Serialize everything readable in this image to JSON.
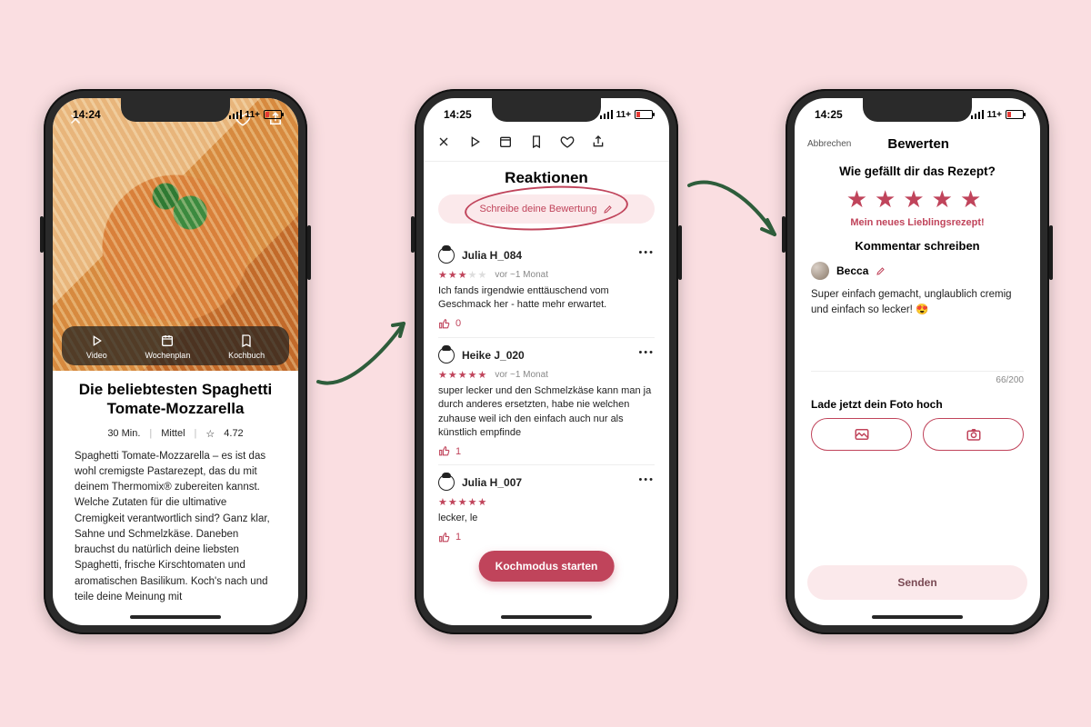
{
  "status": {
    "time1": "14:24",
    "time2": "14:25",
    "time3": "14:25",
    "batt": "11+"
  },
  "phone1": {
    "quick": {
      "video": "Video",
      "plan": "Wochenplan",
      "book": "Kochbuch"
    },
    "title": "Die beliebtesten Spaghetti Tomate-Mozzarella",
    "duration": "30 Min.",
    "difficulty": "Mittel",
    "rating": "4.72",
    "description": "Spaghetti Tomate-Mozzarella – es ist das wohl cremigste Pastarezept, das du mit deinem Thermomix® zubereiten kannst. Welche Zutaten für die ultimative Cremigkeit verantwortlich sind? Ganz klar, Sahne und Schmelzkäse. Daneben brauchst du natürlich deine liebsten Spaghetti, frische Kirschtomaten und aromatischen Basilikum. Koch's nach und teile deine Meinung mit"
  },
  "phone2": {
    "heading": "Reaktionen",
    "write": "Schreibe deine Bewertung",
    "cta": "Kochmodus starten",
    "reviews": [
      {
        "user": "Julia H_084",
        "stars": 3,
        "ago": "vor ~1 Monat",
        "text": "Ich fands irgendwie enttäuschend vom Geschmack her - hatte mehr erwartet.",
        "likes": "0"
      },
      {
        "user": "Heike J_020",
        "stars": 5,
        "ago": "vor ~1 Monat",
        "text": "super lecker und den Schmelzkäse kann man ja durch anderes ersetzten, habe nie welchen zuhause weil ich den einfach auch nur als  künstlich empfinde",
        "likes": "1"
      },
      {
        "user": "Julia H_007",
        "stars": 5,
        "ago": "",
        "text": "lecker, le",
        "likes": "1"
      }
    ]
  },
  "phone3": {
    "cancel": "Abbrechen",
    "title": "Bewerten",
    "question": "Wie gefällt dir das Rezept?",
    "caption": "Mein neues Lieblingsrezept!",
    "subhead": "Kommentar schreiben",
    "author": "Becca",
    "comment": "Super einfach gemacht, unglaublich cremig und einfach so lecker! 😍",
    "counter": "66/200",
    "upload": "Lade jetzt dein Foto hoch",
    "send": "Senden"
  }
}
